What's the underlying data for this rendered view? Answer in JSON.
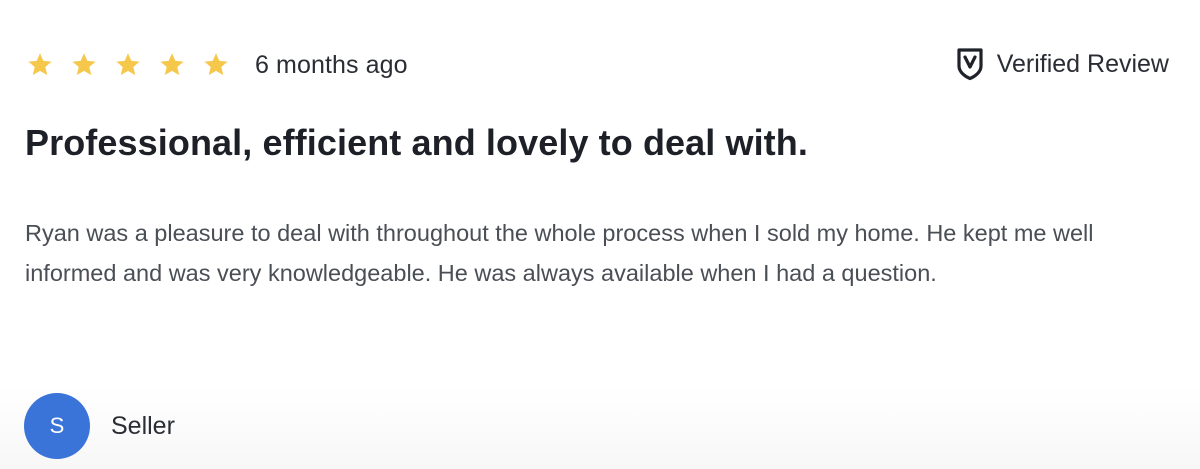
{
  "review": {
    "rating": 5,
    "rating_max": 5,
    "time_ago": "6 months ago",
    "verified_label": "Verified Review",
    "verified_icon": "shield-check-icon",
    "star_icon": "star-icon",
    "title": "Professional, efficient and lovely to deal with.",
    "body": "Ryan was a pleasure to deal with throughout the whole process when I sold my home. He kept me well informed and was very knowledgeable. He was always available when I had a question.",
    "author": {
      "avatar_initial": "S",
      "role": "Seller"
    }
  },
  "colors": {
    "star": "#F5C84C",
    "avatar_bg": "#3A74D8",
    "title_text": "#1D2127",
    "body_text": "#4A4E55"
  }
}
